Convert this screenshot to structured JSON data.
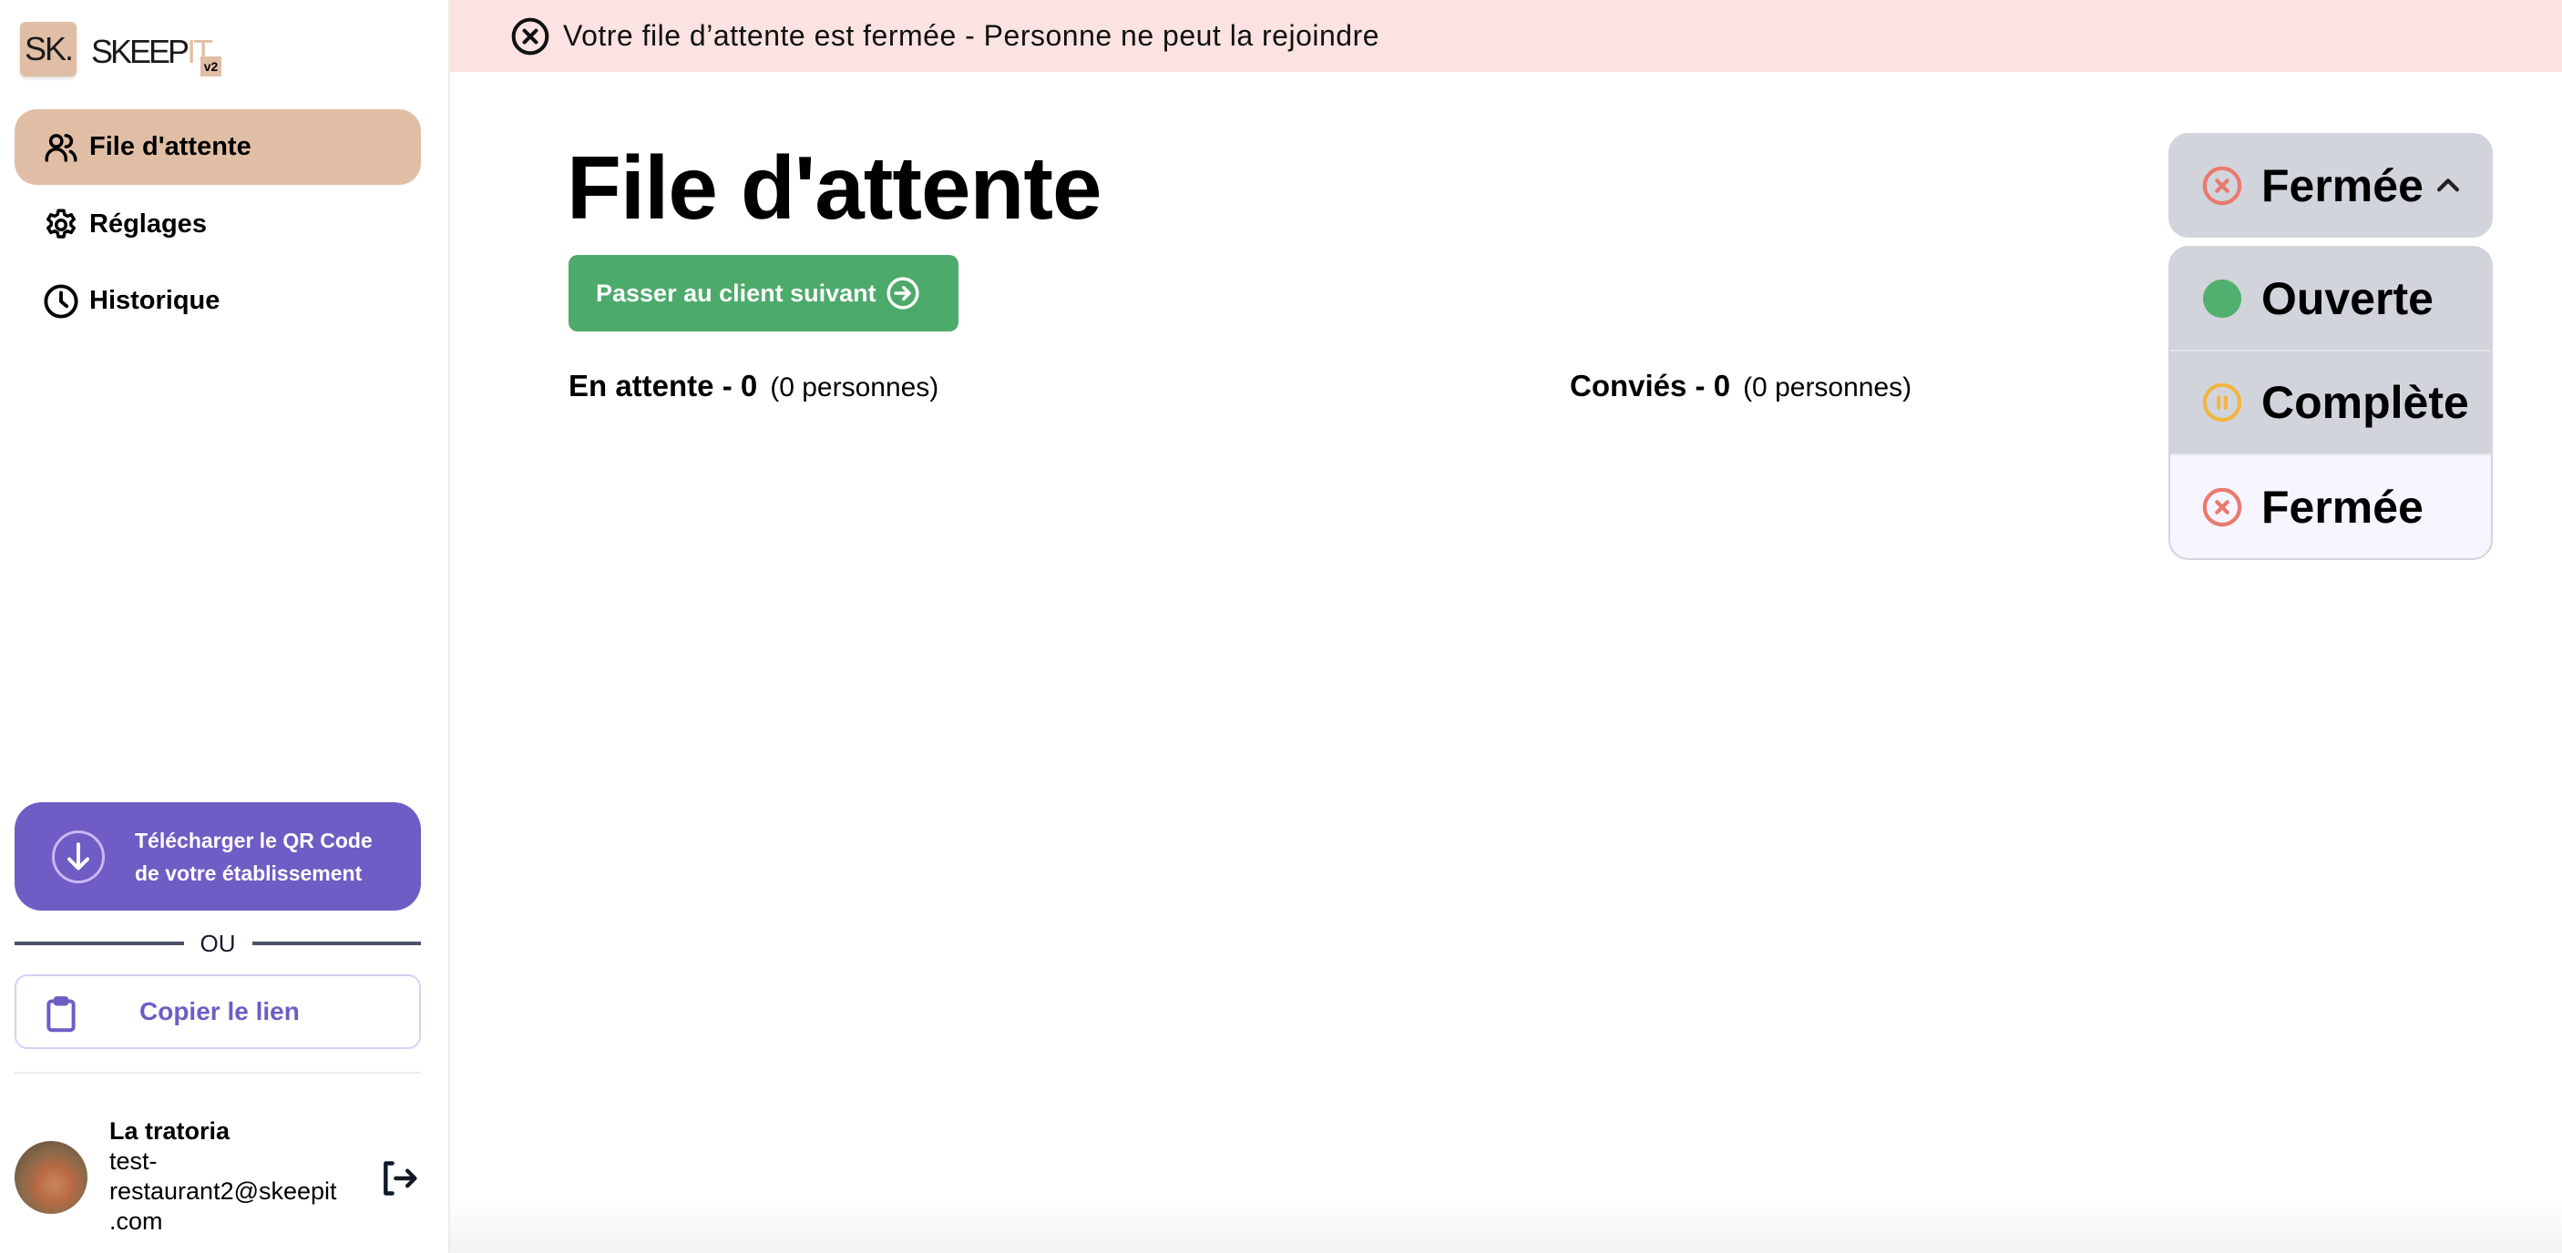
{
  "brand": {
    "logo_mark": "SK.",
    "logo_text_a": "SKEEP",
    "logo_text_b": "IT.",
    "version": "v2",
    "accent": "#e0bea5"
  },
  "sidebar": {
    "items": [
      {
        "label": "File d'attente",
        "icon": "users-icon",
        "active": true
      },
      {
        "label": "Réglages",
        "icon": "gear-icon",
        "active": false
      },
      {
        "label": "Historique",
        "icon": "clock-icon",
        "active": false
      }
    ],
    "qr_button": {
      "line1": "Télécharger le QR Code",
      "line2": "de votre établissement",
      "color": "#6f5cc5"
    },
    "separator": "OU",
    "copy_link": "Copier le lien",
    "user": {
      "name": "La tratoria",
      "email_line1": "test-",
      "email_line2": "restaurant2@skeepit",
      "email_line3": ".com"
    }
  },
  "banner": {
    "text": "Votre file d’attente est fermée - Personne ne peut la rejoindre",
    "color": "#fae3e1"
  },
  "main": {
    "title": "File d'attente",
    "next_button": "Passer au client suivant",
    "waiting": {
      "label": "En attente - 0",
      "people": "(0 personnes)"
    },
    "invited": {
      "label": "Conviés - 0",
      "people": "(0 personnes)"
    }
  },
  "status_dropdown": {
    "selected": "Fermée",
    "expanded": true,
    "options": [
      {
        "label": "Ouverte",
        "color": "#52b06f"
      },
      {
        "label": "Complète",
        "color": "#f2b544"
      },
      {
        "label": "Fermée",
        "color": "#e97a6e"
      }
    ]
  }
}
